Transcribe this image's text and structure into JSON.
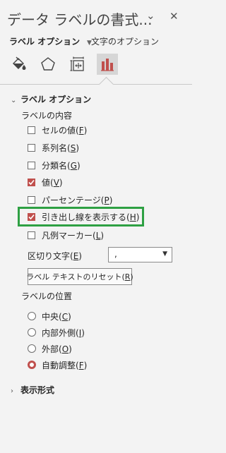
{
  "header": {
    "title": "データ ラベルの書式...",
    "dropdown_glyph": "⌄",
    "close_glyph": "✕"
  },
  "tabs": {
    "label_options": "ラベル オプション",
    "text_options": "文字のオプション"
  },
  "icons": [
    "fill-line-icon",
    "effects-pentagon-icon",
    "size-properties-icon",
    "bar-chart-icon"
  ],
  "section_label_options": {
    "title": "ラベル オプション",
    "contents_title": "ラベルの内容",
    "checkboxes": [
      {
        "label": "セルの値(",
        "key": "F",
        "end": ")",
        "checked": false
      },
      {
        "label": "系列名(",
        "key": "S",
        "end": ")",
        "checked": false
      },
      {
        "label": "分類名(",
        "key": "G",
        "end": ")",
        "checked": false
      },
      {
        "label": "値(",
        "key": "V",
        "end": ")",
        "checked": true
      },
      {
        "label": "パーセンテージ(",
        "key": "P",
        "end": ")",
        "checked": false
      },
      {
        "label": "引き出し線を表示する(",
        "key": "H",
        "end": ")",
        "checked": true
      },
      {
        "label": "凡例マーカー(",
        "key": "L",
        "end": ")",
        "checked": false
      }
    ],
    "separator": {
      "label": "区切り文字(",
      "key": "E",
      "end": ")",
      "value": ","
    },
    "reset_button": {
      "label": "ラベル テキストのリセット(",
      "key": "R",
      "end": ")"
    },
    "position_title": "ラベルの位置",
    "positions": [
      {
        "label": "中央(",
        "key": "C",
        "end": ")",
        "checked": false
      },
      {
        "label": "内部外側(",
        "key": "I",
        "end": ")",
        "checked": false
      },
      {
        "label": "外部(",
        "key": "O",
        "end": ")",
        "checked": false
      },
      {
        "label": "自動調整(",
        "key": "F",
        "end": ")",
        "checked": true
      }
    ]
  },
  "section_number": {
    "title": "表示形式"
  },
  "colors": {
    "accent": "#c0504d",
    "highlight": "#2ea043",
    "background": "#f3f3f3"
  }
}
